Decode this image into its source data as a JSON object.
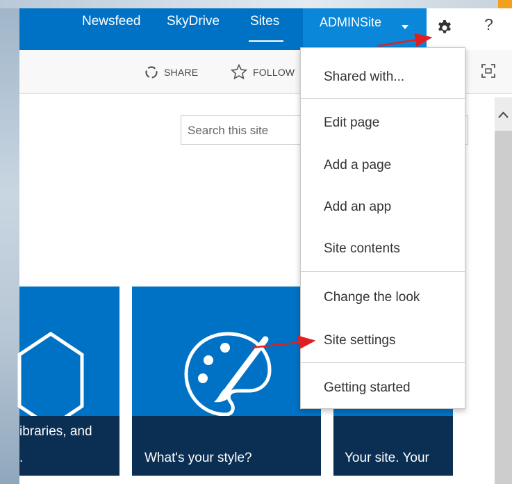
{
  "suite_bar": {
    "links": [
      {
        "label": "Newsfeed"
      },
      {
        "label": "SkyDrive"
      },
      {
        "label": "Sites"
      }
    ],
    "user_menu": "ADMINSite",
    "help": "?"
  },
  "ribbon": {
    "share": "SHARE",
    "follow": "FOLLOW"
  },
  "search": {
    "placeholder": "Search this site"
  },
  "settings_menu": {
    "items": [
      {
        "label": "Shared with..."
      },
      {
        "label": "Edit page"
      },
      {
        "label": "Add a page"
      },
      {
        "label": "Add an app"
      },
      {
        "label": "Site contents"
      },
      {
        "label": "Change the look"
      },
      {
        "label": "Site settings"
      },
      {
        "label": "Getting started"
      }
    ]
  },
  "tiles": [
    {
      "caption_line1": "ibraries, and",
      "caption_line2": "."
    },
    {
      "caption": "What's your style?"
    },
    {
      "caption": "Your site. Your"
    }
  ],
  "colors": {
    "suite_blue": "#0072c6",
    "tile_caption": "#0b2f53",
    "annotation_arrow": "#e02020"
  }
}
